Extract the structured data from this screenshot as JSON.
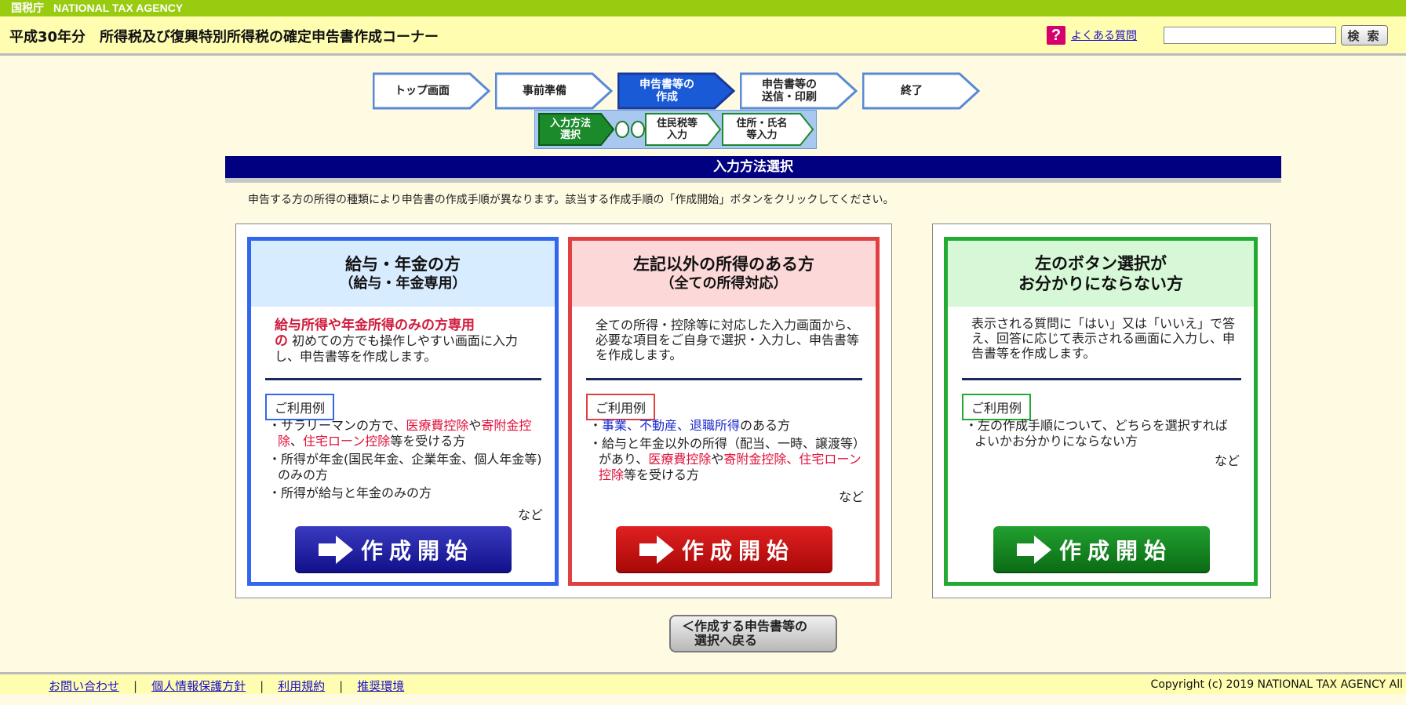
{
  "topbar": {
    "kanji": "国税庁",
    "agency": "NATIONAL TAX AGENCY"
  },
  "header": {
    "title": "平成30年分　所得税及び復興特別所得税の確定申告書作成コーナー",
    "faq_icon": "?",
    "faq_link": "よくある質問",
    "search_value": "",
    "search_button": "検 索"
  },
  "steps": [
    {
      "label": "トップ画面"
    },
    {
      "label": "事前準備"
    },
    {
      "label": "申告書等の\n作成",
      "active": true
    },
    {
      "label": "申告書等の\n送信・印刷"
    },
    {
      "label": "終了"
    }
  ],
  "substeps": [
    {
      "label": "入力方法\n選択",
      "active": true
    },
    {
      "label": "住民税等\n入力"
    },
    {
      "label": "住所・氏名\n等入力"
    }
  ],
  "page_heading": "入力方法選択",
  "intro": "申告する方の所得の種類により申告書の作成手順が異なります。該当する作成手順の「作成開始」ボタンをクリックしてください。",
  "cards": {
    "salary": {
      "title": "給与・年金の方",
      "subtitle": "（給与・年金専用）",
      "highlight_1": "給与所得や年金所得のみの方専用",
      "highlight_2": "の",
      "desc": " 初めての方でも操作しやすい画面に入力し、申告書等を作成します。",
      "usage_label": "ご利用例",
      "item1_a": "サラリーマンの方で、",
      "item1_b": "医療費控除",
      "item1_c": "や",
      "item1_d": "寄附金控除",
      "item1_e": "、",
      "item1_f": "住宅ローン控除",
      "item1_g": "等を受ける方",
      "item2": "所得が年金(国民年金、企業年金、個人年金等)のみの方",
      "item3": "所得が給与と年金のみの方",
      "nado": "など",
      "button": "作成開始"
    },
    "other": {
      "title": "左記以外の所得のある方",
      "subtitle": "（全ての所得対応）",
      "desc": "全ての所得・控除等に対応した入力画面から、必要な項目をご自身で選択・入力し、申告書等を作成します。",
      "usage_label": "ご利用例",
      "item1_a": "事業、不動産、退職所得",
      "item1_b": "のある方",
      "item2_a": "給与と年金以外の所得（配当、一時、譲渡等）があり、",
      "item2_b": "医療費控除",
      "item2_c": "や",
      "item2_d": "寄附金控除、住宅ローン控除",
      "item2_e": "等を受ける方",
      "nado": "など",
      "button": "作成開始"
    },
    "unsure": {
      "title": "左のボタン選択が",
      "subtitle": "お分かりにならない方",
      "desc": "表示される質問に「はい」又は「いいえ」で答え、回答に応じて表示される画面に入力し、申告書等を作成します。",
      "usage_label": "ご利用例",
      "item1": "左の作成手順について、どちらを選択すればよいかお分かりにならない方",
      "nado": "など",
      "button": "作成開始"
    }
  },
  "back_button": "＜作成する申告書等の\n　選択へ戻る",
  "footer": {
    "links": [
      "お問い合わせ",
      "個人情報保護方針",
      "利用規約",
      "推奨環境"
    ],
    "separator": "|",
    "copyright": "Copyright (c) 2019 NATIONAL TAX AGENCY All"
  },
  "colors": {
    "topbar": "#99cc11",
    "header": "#fffeb0",
    "heading": "#000080",
    "salary": "#3366ee",
    "other": "#e04040",
    "unsure": "#22aa33"
  }
}
